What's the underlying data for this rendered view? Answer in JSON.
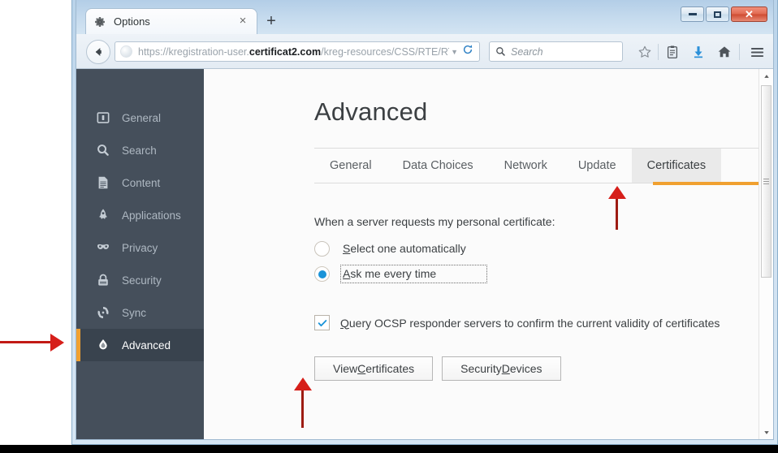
{
  "window": {
    "controls": {
      "minimize": "minimize-button",
      "maximize": "maximize-button",
      "close": "close-button",
      "close_glyph": "✕"
    }
  },
  "browser": {
    "tab": {
      "title": "Options",
      "icon": "gear-icon",
      "close_glyph": "×"
    },
    "new_tab_glyph": "+",
    "back_button": "back-icon",
    "url": {
      "prefix": "https://kregistration-user.",
      "domain": "certificat2.com",
      "suffix": "/kreg-resources/CSS/RTE/RTE/Cer",
      "dropdown_glyph": "▼",
      "reload_icon": "reload-icon"
    },
    "search": {
      "placeholder": "Search",
      "icon": "search-icon"
    },
    "toolbar_icons": [
      "bookmark-star-icon",
      "reading-list-icon",
      "downloads-icon",
      "home-icon",
      "menu-hamburger-icon"
    ]
  },
  "sidebar": {
    "items": [
      {
        "label": "General",
        "icon": "general-icon",
        "selected": false
      },
      {
        "label": "Search",
        "icon": "search-icon",
        "selected": false
      },
      {
        "label": "Content",
        "icon": "content-page-icon",
        "selected": false
      },
      {
        "label": "Applications",
        "icon": "applications-rocket-icon",
        "selected": false
      },
      {
        "label": "Privacy",
        "icon": "privacy-mask-icon",
        "selected": false
      },
      {
        "label": "Security",
        "icon": "security-lock-icon",
        "selected": false
      },
      {
        "label": "Sync",
        "icon": "sync-icon",
        "selected": false
      },
      {
        "label": "Advanced",
        "icon": "advanced-flask-icon",
        "selected": true
      }
    ]
  },
  "page": {
    "title": "Advanced",
    "tabs": [
      {
        "label": "General",
        "active": false
      },
      {
        "label": "Data Choices",
        "active": false
      },
      {
        "label": "Network",
        "active": false
      },
      {
        "label": "Update",
        "active": false
      },
      {
        "label": "Certificates",
        "active": true
      }
    ],
    "certificates": {
      "prompt": "When a server requests my personal certificate:",
      "options": [
        {
          "label_accel": "S",
          "label_rest": "elect one automatically",
          "selected": false,
          "focused": false
        },
        {
          "label_accel": "A",
          "label_rest": "sk me every time",
          "selected": true,
          "focused": true
        }
      ],
      "ocsp": {
        "label_accel": "Q",
        "label_rest": "uery OCSP responder servers to confirm the current validity of certificates",
        "checked": true,
        "check_glyph": "✓"
      },
      "buttons": [
        {
          "pre": "View ",
          "accel": "C",
          "post": "ertificates"
        },
        {
          "pre": "Security ",
          "accel": "D",
          "post": "evices"
        }
      ]
    }
  },
  "scrollbar": {
    "up_glyph": "▲",
    "down_glyph": "▼"
  },
  "colors": {
    "accent_orange": "#f0a030",
    "sidebar_bg": "#454f5b",
    "sidebar_selected_bg": "#39434e",
    "radio_blue": "#1a93d8",
    "annotation_red": "#d61f1a"
  }
}
